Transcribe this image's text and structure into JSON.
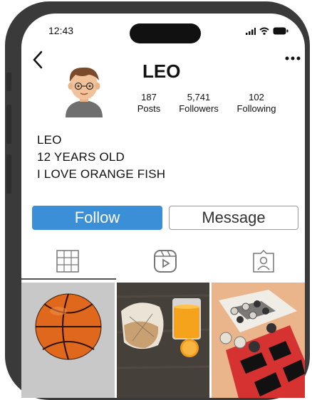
{
  "status_bar": {
    "time": "12:43"
  },
  "profile": {
    "username": "LEO",
    "stats": [
      {
        "value": "187",
        "label": "Posts"
      },
      {
        "value": "5,741",
        "label": "Followers"
      },
      {
        "value": "102",
        "label": "Following"
      }
    ],
    "bio": [
      "LEO",
      "12 YEARS OLD",
      "I LOVE ORANGE FISH"
    ]
  },
  "actions": {
    "follow_label": "Follow",
    "message_label": "Message"
  },
  "icons": {
    "back": "chevron-left-icon",
    "more": "more-icon",
    "grid_tab": "grid-icon",
    "reels_tab": "reels-icon",
    "tagged_tab": "tagged-icon"
  },
  "colors": {
    "follow_button": "#3b8fd6",
    "phone_frame": "#3a3a3a"
  },
  "posts": [
    {
      "subject": "basketball"
    },
    {
      "subject": "bread and orange juice"
    },
    {
      "subject": "checkers board"
    }
  ]
}
